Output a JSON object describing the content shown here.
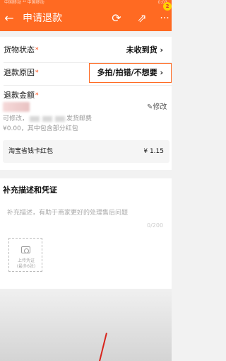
{
  "status_bar": {
    "left": "中国移动 ⁴⁶ 中国移动",
    "right": "0:03"
  },
  "header": {
    "back_icon": "back-arrow-icon",
    "title": "申请退款",
    "badge_count": "2",
    "icons": [
      "refresh-icon",
      "share-icon",
      "more-icon"
    ]
  },
  "form": {
    "goods_status": {
      "label": "货物状态",
      "required_mark": "*",
      "value": "未收到货",
      "chevron": "›"
    },
    "refund_reason": {
      "label": "退款原因",
      "required_mark": "*",
      "value": "多拍/拍错/不想要",
      "chevron": "›"
    },
    "refund_amount": {
      "label": "退款金额",
      "required_mark": "*",
      "edit_label": "修改",
      "note_line1_prefix": "可修改，",
      "note_line1_suffix": "发货邮费",
      "note_line2": "¥0.00，其中包含部分红包"
    },
    "red_packet": {
      "name": "淘宝省钱卡红包",
      "amount": "¥ 1.15"
    }
  },
  "evidence": {
    "title": "补充描述和凭证",
    "placeholder": "补充描述，有助于商家更好的处理售后问题",
    "counter": "0/200",
    "upload_label_line1": "上传凭证",
    "upload_label_line2": "(最多6张)"
  },
  "colors": {
    "accent": "#ff6a22",
    "required": "#ff3c00",
    "annotation_arrow": "#d8241c"
  }
}
